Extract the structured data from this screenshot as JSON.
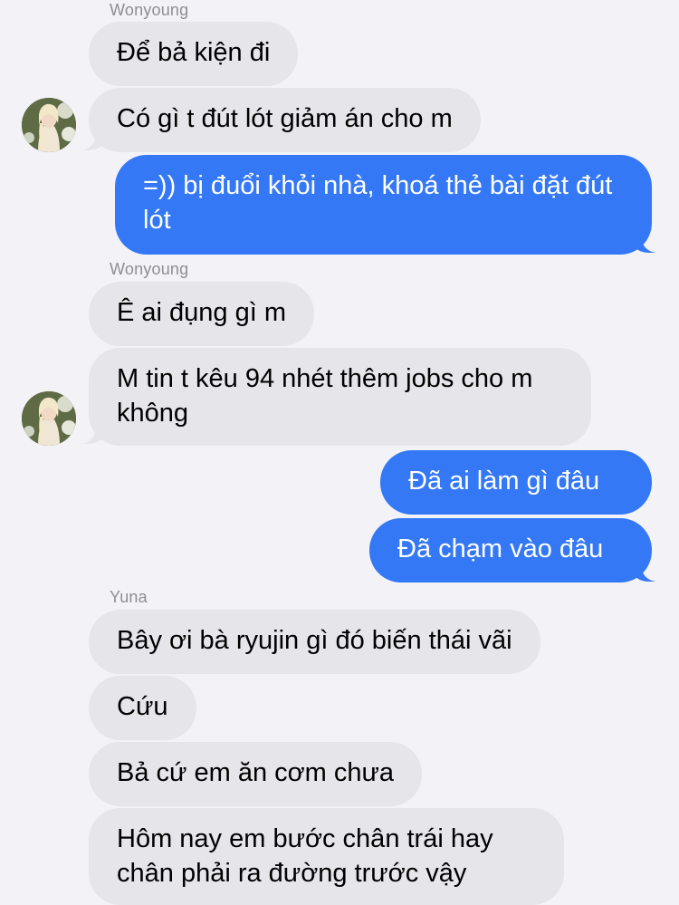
{
  "senders": {
    "first": "Wonyoung",
    "second": "Wonyoung",
    "third": "Yuna"
  },
  "messages": [
    {
      "text": "Để bả kiện đi",
      "direction": "incoming"
    },
    {
      "text": "Có gì t đút lót giảm án cho m",
      "direction": "incoming"
    },
    {
      "text": "=)) bị đuổi khỏi nhà, khoá thẻ bài đặt đút lót",
      "direction": "outgoing"
    },
    {
      "text": "Ê ai đụng gì m",
      "direction": "incoming"
    },
    {
      "text": "M tin t kêu 94 nhét thêm jobs cho m không",
      "direction": "incoming"
    },
    {
      "text": "Đã ai làm gì đâu",
      "direction": "outgoing"
    },
    {
      "text": "Đã chạm vào đâu",
      "direction": "outgoing"
    },
    {
      "text": "Bây ơi bà ryujin gì đó biến thái vãi",
      "direction": "incoming"
    },
    {
      "text": "Cứu",
      "direction": "incoming"
    },
    {
      "text": "Bả cứ em ăn cơm chưa",
      "direction": "incoming"
    },
    {
      "text": "Hôm nay em bước chân trái hay chân phải ra đường trước vậy",
      "direction": "incoming"
    }
  ],
  "colors": {
    "background": "#f2f2f7",
    "incoming_bubble": "#e5e5ea",
    "outgoing_bubble": "#3478f6",
    "sender_label": "#8e8e93"
  },
  "icons": {
    "avatar": "avatar-photo"
  }
}
